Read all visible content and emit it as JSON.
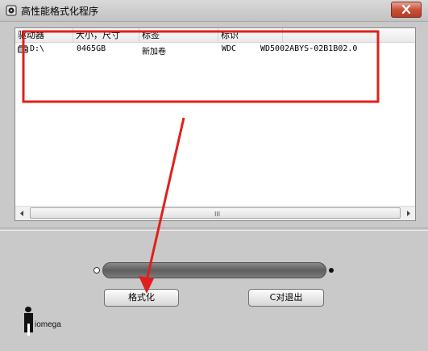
{
  "window": {
    "title": "高性能格式化程序"
  },
  "list": {
    "columns": [
      "驱动器",
      "大小，尺寸",
      "标签",
      "标识"
    ],
    "rows": [
      {
        "drive": "D:\\",
        "size": "0465GB",
        "label": "新加卷",
        "vendor": "WDC",
        "model": "WD5002ABYS-02B1B02.0"
      }
    ],
    "scroll_grip": "III"
  },
  "buttons": {
    "format": "格式化",
    "exit": "C对退出"
  },
  "logo": {
    "text": "iomega"
  },
  "progress": {
    "value": 0
  },
  "colors": {
    "annotation": "#e0201c"
  }
}
